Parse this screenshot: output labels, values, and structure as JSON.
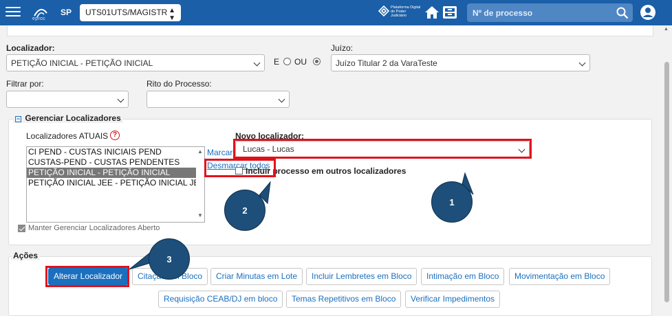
{
  "topbar": {
    "logo_text": "eproc",
    "state": "SP",
    "org_select": "UTS01UTS/MAGISTR",
    "pdpj_label": "Plataforma Digital do Poder Judiciário",
    "search_placeholder": "Nº de processo"
  },
  "form": {
    "localizador_label": "Localizador:",
    "localizador_value": "PETIÇÃO INICIAL - PETIÇÃO INICIAL",
    "e_label": "E",
    "ou_label": "OU",
    "juizo_label": "Juízo:",
    "juizo_value": "Juízo Titular 2 da VaraTeste",
    "filtrar_label": "Filtrar por:",
    "rito_label": "Rito do Processo:"
  },
  "gerenciar": {
    "legend": "Gerenciar Localizadores",
    "toggle": "−",
    "atuais_label": "Localizadores ATUAIS",
    "help_icon": "?",
    "atuais_items": [
      "CI PEND - CUSTAS INICIAIS PEND",
      "CUSTAS-PEND - CUSTAS PENDENTES",
      "PETIÇÃO INICIAL - PETIÇÃO INICIAL",
      "PETIÇÃO INICIAL JEE - PETIÇÃO INICIAL JEE"
    ],
    "selected_index": 2,
    "marcar_todos": "Marcar",
    "desmarcar_todos": "Desmarcar todos",
    "novo_label": "Novo localizador:",
    "novo_value": "Lucas - Lucas",
    "incluir_label": "Incluir processo em outros localizadores",
    "manter_label": "Manter Gerenciar Localizadores Aberto"
  },
  "acoes": {
    "legend": "Ações",
    "row1": [
      "Alterar Localizador",
      "Citação em Bloco",
      "Criar Minutas em Lote",
      "Incluir Lembretes em Bloco",
      "Intimação em Bloco",
      "Movimentação em Bloco"
    ],
    "row2": [
      "Requisição CEAB/DJ em bloco",
      "Temas Repetitivos em Bloco",
      "Verificar Impedimentos"
    ]
  },
  "callouts": [
    "1",
    "2",
    "3"
  ],
  "colors": {
    "topbar": "#1a5fa8",
    "primary": "#1a6fbf",
    "highlight": "#e1111b",
    "callout": "#1d4f7a"
  }
}
